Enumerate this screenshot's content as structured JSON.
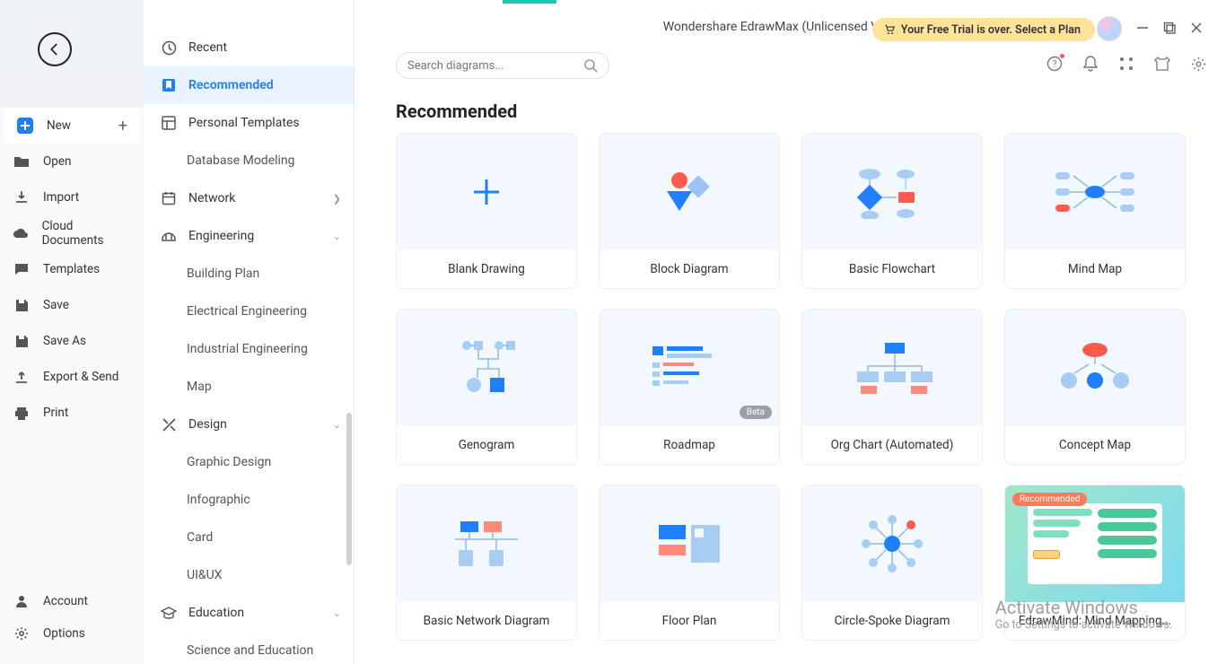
{
  "window": {
    "title": "Wondershare EdrawMax (Unlicensed Version)",
    "trial_banner": "Your Free Trial is over. Select a Plan"
  },
  "left_rail": {
    "items": [
      {
        "id": "new",
        "label": "New",
        "icon": "plus-square",
        "active": true,
        "trail": "plus"
      },
      {
        "id": "open",
        "label": "Open",
        "icon": "folder"
      },
      {
        "id": "import",
        "label": "Import",
        "icon": "download"
      },
      {
        "id": "cloud",
        "label": "Cloud Documents",
        "icon": "cloud"
      },
      {
        "id": "templates",
        "label": "Templates",
        "icon": "message"
      },
      {
        "id": "save",
        "label": "Save",
        "icon": "save"
      },
      {
        "id": "saveas",
        "label": "Save As",
        "icon": "save"
      },
      {
        "id": "export",
        "label": "Export & Send",
        "icon": "upload"
      },
      {
        "id": "print",
        "label": "Print",
        "icon": "printer"
      }
    ],
    "bottom": [
      {
        "id": "account",
        "label": "Account",
        "icon": "user"
      },
      {
        "id": "options",
        "label": "Options",
        "icon": "gear"
      }
    ]
  },
  "mid_rail": {
    "items": [
      {
        "type": "section",
        "id": "recent",
        "label": "Recent",
        "icon": "clock"
      },
      {
        "type": "section",
        "id": "recommended",
        "label": "Recommended",
        "icon": "bookmark",
        "selected": true
      },
      {
        "type": "section",
        "id": "personal",
        "label": "Personal Templates",
        "icon": "layout"
      },
      {
        "type": "child",
        "id": "dbmodel",
        "label": "Database Modeling"
      },
      {
        "type": "section",
        "id": "network",
        "label": "Network",
        "icon": "calendar",
        "chev": "right"
      },
      {
        "type": "section",
        "id": "engineering",
        "label": "Engineering",
        "icon": "helmet",
        "chev": "down"
      },
      {
        "type": "child",
        "id": "building",
        "label": "Building Plan"
      },
      {
        "type": "child",
        "id": "elec",
        "label": "Electrical Engineering"
      },
      {
        "type": "child",
        "id": "indus",
        "label": "Industrial Engineering"
      },
      {
        "type": "child",
        "id": "map",
        "label": "Map"
      },
      {
        "type": "section",
        "id": "design",
        "label": "Design",
        "icon": "design",
        "chev": "down"
      },
      {
        "type": "child",
        "id": "graphic",
        "label": "Graphic Design"
      },
      {
        "type": "child",
        "id": "infog",
        "label": "Infographic"
      },
      {
        "type": "child",
        "id": "card",
        "label": "Card"
      },
      {
        "type": "child",
        "id": "uiux",
        "label": "UI&UX"
      },
      {
        "type": "section",
        "id": "education",
        "label": "Education",
        "icon": "grad",
        "chev": "down"
      },
      {
        "type": "child",
        "id": "sciedu",
        "label": "Science and Education"
      }
    ]
  },
  "search": {
    "placeholder": "Search diagrams..."
  },
  "section_heading": "Recommended",
  "templates": [
    [
      {
        "id": "blank",
        "label": "Blank Drawing",
        "thumb": "plus"
      },
      {
        "id": "block",
        "label": "Block Diagram",
        "thumb": "shapes"
      },
      {
        "id": "flow",
        "label": "Basic Flowchart",
        "thumb": "flow"
      },
      {
        "id": "mind",
        "label": "Mind Map",
        "thumb": "mind"
      }
    ],
    [
      {
        "id": "geno",
        "label": "Genogram",
        "thumb": "geno"
      },
      {
        "id": "road",
        "label": "Roadmap",
        "thumb": "road",
        "badge": "Beta"
      },
      {
        "id": "org",
        "label": "Org Chart (Automated)",
        "thumb": "org"
      },
      {
        "id": "concept",
        "label": "Concept Map",
        "thumb": "concept"
      }
    ],
    [
      {
        "id": "net",
        "label": "Basic Network Diagram",
        "thumb": "net"
      },
      {
        "id": "floor",
        "label": "Floor Plan",
        "thumb": "floor"
      },
      {
        "id": "spoke",
        "label": "Circle-Spoke Diagram",
        "thumb": "spoke"
      },
      {
        "id": "edrawmind",
        "label": "EdrawMind: Mind Mapping...",
        "thumb": "em",
        "badge": "Recommended",
        "badgeClass": "rec",
        "special": true
      }
    ]
  ],
  "watermark": {
    "l1": "Activate Windows",
    "l2": "Go to Settings to activate Windows."
  }
}
